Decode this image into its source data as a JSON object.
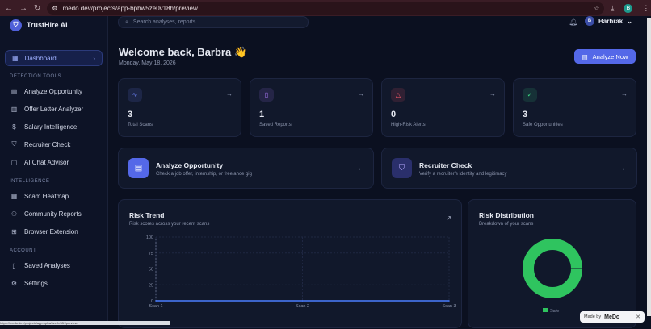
{
  "browser": {
    "url": "medo.dev/projects/app-bphw5ze0v18h/preview",
    "profile_initial": "B"
  },
  "brand": {
    "name": "TrustHire AI"
  },
  "sidebar": {
    "active": "Dashboard",
    "sections": [
      {
        "title": "DETECTION TOOLS",
        "items": [
          {
            "label": "Analyze Opportunity",
            "icon": "document-icon"
          },
          {
            "label": "Offer Letter Analyzer",
            "icon": "file-icon"
          },
          {
            "label": "Salary Intelligence",
            "icon": "dollar-icon"
          },
          {
            "label": "Recruiter Check",
            "icon": "shield-icon"
          },
          {
            "label": "AI Chat Advisor",
            "icon": "chat-icon"
          }
        ]
      },
      {
        "title": "INTELLIGENCE",
        "items": [
          {
            "label": "Scam Heatmap",
            "icon": "map-icon"
          },
          {
            "label": "Community Reports",
            "icon": "users-icon"
          },
          {
            "label": "Browser Extension",
            "icon": "puzzle-icon"
          }
        ]
      },
      {
        "title": "ACCOUNT",
        "items": [
          {
            "label": "Saved Analyses",
            "icon": "bookmark-icon"
          },
          {
            "label": "Settings",
            "icon": "gear-icon"
          }
        ]
      }
    ]
  },
  "topbar": {
    "search_placeholder": "Search analyses, reports...",
    "user_name": "Barbrak",
    "user_initial": "B"
  },
  "header": {
    "welcome": "Welcome back, Barbra 👋",
    "date": "Monday, May 18, 2026",
    "cta": "Analyze Now"
  },
  "stats": [
    {
      "value": "3",
      "label": "Total Scans",
      "icon": "pulse-icon",
      "color": "#6f86ff"
    },
    {
      "value": "1",
      "label": "Saved Reports",
      "icon": "bookmark-icon",
      "color": "#b07cff"
    },
    {
      "value": "0",
      "label": "High-Risk Alerts",
      "icon": "alert-icon",
      "color": "#ff5a6b"
    },
    {
      "value": "3",
      "label": "Safe Opportunities",
      "icon": "check-circle-icon",
      "color": "#3ddc84"
    }
  ],
  "actions": [
    {
      "title": "Analyze Opportunity",
      "subtitle": "Check a job offer, internship, or freelance gig"
    },
    {
      "title": "Recruiter Check",
      "subtitle": "Verify a recruiter's identity and legitimacy"
    }
  ],
  "risk_trend": {
    "title": "Risk Trend",
    "subtitle": "Risk scores across your recent scans"
  },
  "risk_distribution": {
    "title": "Risk Distribution",
    "subtitle": "Breakdown of your scans"
  },
  "chart_data": [
    {
      "type": "line",
      "title": "Risk Trend",
      "categories": [
        "Scan 1",
        "Scan 2",
        "Scan 3"
      ],
      "series": [
        {
          "values": [
            0,
            0,
            0
          ]
        }
      ],
      "ylim": [
        0,
        100
      ],
      "yticks": [
        0,
        25,
        50,
        75,
        100
      ],
      "grid": true,
      "color": "#4a7dff"
    },
    {
      "type": "pie",
      "title": "Risk Distribution",
      "labels": [
        "Safe"
      ],
      "values": [
        3
      ],
      "colors": [
        "#2fc45f"
      ],
      "legend": "bottom"
    }
  ],
  "badge": {
    "made_by": "Made by",
    "brand": "MeDo"
  },
  "status_text": "https://medo.dev/projects/app-bphw5ze0v18h/preview"
}
